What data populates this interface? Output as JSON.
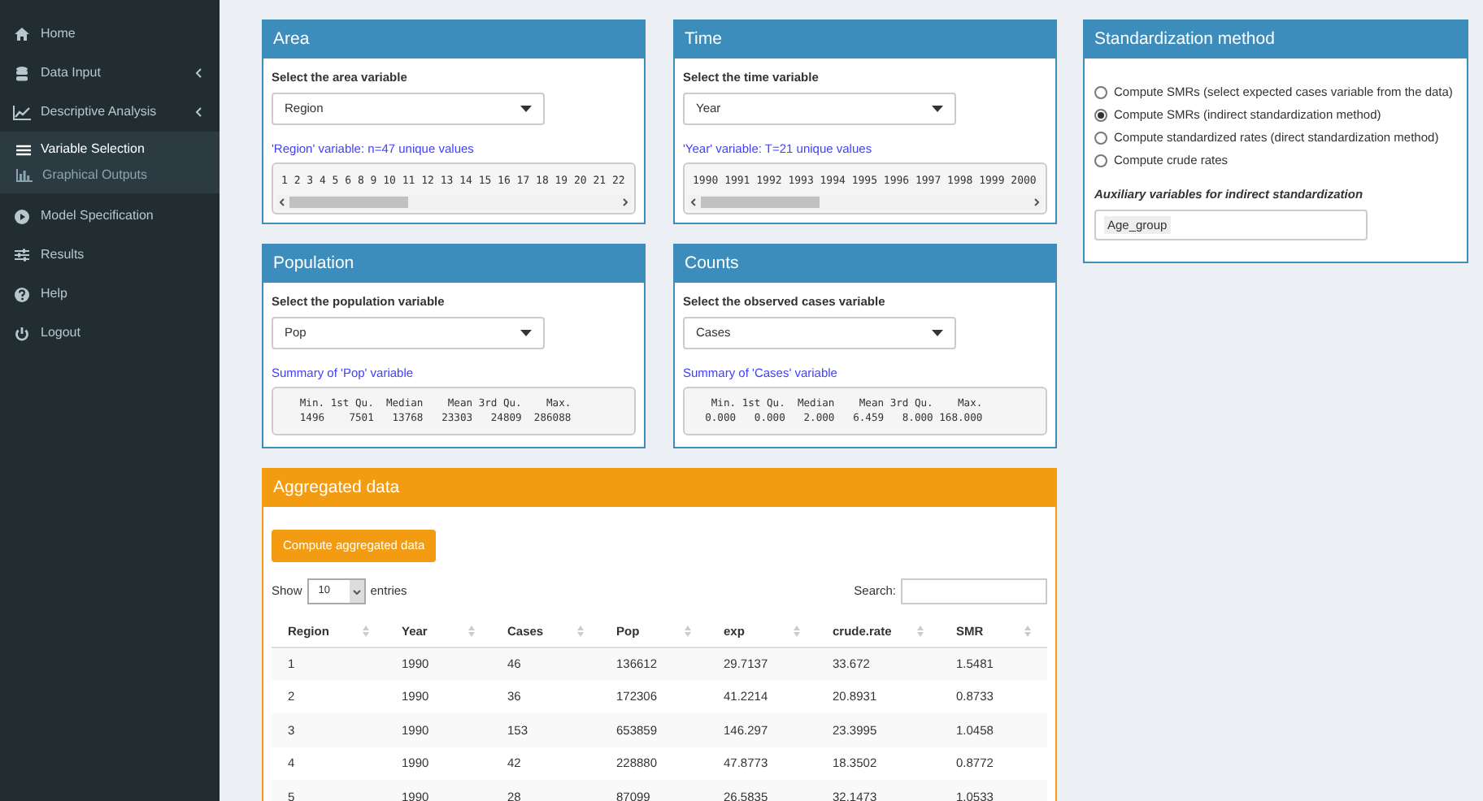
{
  "sidebar": {
    "items": [
      {
        "label": "Home",
        "kind": "link",
        "selected": false
      },
      {
        "label": "Data Input",
        "kind": "treeview",
        "selected": false
      },
      {
        "label": "Descriptive Analysis",
        "kind": "treeview",
        "selected": false,
        "children": [
          {
            "label": "Variable Selection",
            "selected": true
          },
          {
            "label": "Graphical Outputs",
            "selected": false
          }
        ]
      },
      {
        "label": "Model Specification",
        "kind": "link",
        "selected": false
      },
      {
        "label": "Results",
        "kind": "link",
        "selected": false
      },
      {
        "label": "Help",
        "kind": "link",
        "selected": false
      },
      {
        "label": "Logout",
        "kind": "link",
        "selected": false
      }
    ]
  },
  "variable_boxes": [
    {
      "title": "Area",
      "field_label": "Select the area variable",
      "value": "Region",
      "info": "'Region' variable: n=47 unique values",
      "output": "1 2 3 4 5 6 8 9 10 11 12 13 14 15 16 17 18 19 20 21 22",
      "kind": "scroll"
    },
    {
      "title": "Time",
      "field_label": "Select the time variable",
      "value": "Year",
      "info": "'Year' variable: T=21 unique values",
      "output": "1990 1991 1992 1993 1994 1995 1996 1997 1998 1999 2000",
      "kind": "scroll"
    },
    {
      "title": "Population",
      "field_label": "Select the population variable",
      "value": "Pop",
      "info": "Summary of 'Pop' variable",
      "output": "   Min. 1st Qu.  Median    Mean 3rd Qu.    Max. \n   1496    7501   13768   23303   24809  286088 ",
      "kind": "summary"
    },
    {
      "title": "Counts",
      "field_label": "Select the observed cases variable",
      "value": "Cases",
      "info": "Summary of 'Cases' variable",
      "output": "   Min. 1st Qu.  Median    Mean 3rd Qu.    Max. \n  0.000   0.000   2.000   6.459   8.000 168.000 ",
      "kind": "summary"
    }
  ],
  "standardization": {
    "title": "Standardization method",
    "options": [
      {
        "label": "Compute SMRs (select expected cases variable from the data)",
        "selected": false
      },
      {
        "label": "Compute SMRs (indirect standardization method)",
        "selected": true
      },
      {
        "label": "Compute standardized rates (direct standardization method)",
        "selected": false
      },
      {
        "label": "Compute crude rates",
        "selected": false
      }
    ],
    "aux_label": "Auxiliary variables for indirect standardization",
    "aux_values": [
      "Age_group"
    ]
  },
  "aggregated": {
    "title": "Aggregated data",
    "button": "Compute aggregated data",
    "show_label": "Show",
    "page_size": "10",
    "entries_label": "entries",
    "search_label": "Search:",
    "table": {
      "columns": [
        "Region",
        "Year",
        "Cases",
        "Pop",
        "exp",
        "crude.rate",
        "SMR"
      ],
      "rows": [
        [
          "1",
          "1990",
          "46",
          "136612",
          "29.7137",
          "33.672",
          "1.5481"
        ],
        [
          "2",
          "1990",
          "36",
          "172306",
          "41.2214",
          "20.8931",
          "0.8733"
        ],
        [
          "3",
          "1990",
          "153",
          "653859",
          "146.297",
          "23.3995",
          "1.0458"
        ],
        [
          "4",
          "1990",
          "42",
          "228880",
          "47.8773",
          "18.3502",
          "0.8772"
        ],
        [
          "5",
          "1990",
          "28",
          "87099",
          "26.5835",
          "32.1473",
          "1.0533"
        ]
      ]
    }
  }
}
